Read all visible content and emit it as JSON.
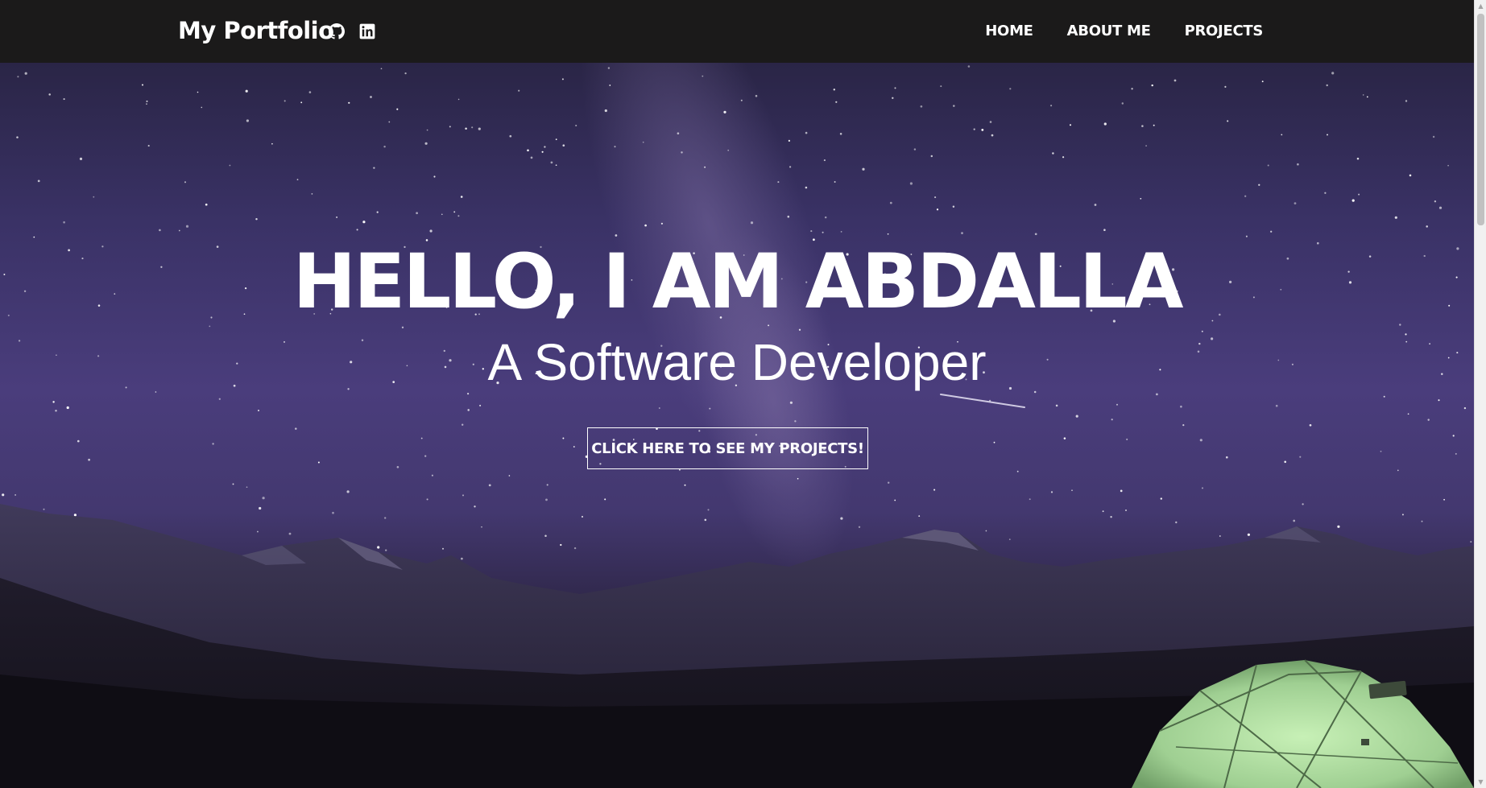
{
  "navbar": {
    "brand": "My Portfolio",
    "links": [
      "HOME",
      "ABOUT ME",
      "PROJECTS"
    ],
    "social_icons": [
      "github-icon",
      "linkedin-icon"
    ]
  },
  "hero": {
    "title": "HELLO, I AM ABDALLA",
    "subtitle": "A Software Developer",
    "cta_label": "CLICK HERE TO SEE MY PROJECTS!",
    "background": "night sky with milky way, mountains and a lit green tent"
  },
  "colors": {
    "navbar_bg": "#1b1a1a",
    "text": "#ffffff",
    "sky_top": "#2a2546",
    "sky_mid": "#4a3d7c",
    "ground": "#15121c",
    "tent": "#a6d99a"
  },
  "scrollbar": {
    "up_arrow": "▲",
    "down_arrow": "▼"
  }
}
